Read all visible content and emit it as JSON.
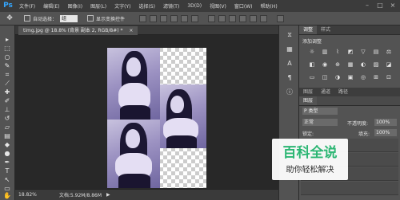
{
  "menubar": {
    "logo": "Ps",
    "items": [
      "文件(F)",
      "编辑(E)",
      "图像(I)",
      "图层(L)",
      "文字(Y)",
      "选择(S)",
      "滤镜(T)",
      "3D(D)",
      "视图(V)",
      "窗口(W)",
      "帮助(H)"
    ],
    "controls": [
      "–",
      "□",
      "×"
    ]
  },
  "options": {
    "autoselect_label": "自动选择：",
    "autoselect_value": "组",
    "transform_label": "显示变换控件"
  },
  "document": {
    "tab_title": "timg.jpg @ 18.8% (背景 副本 2, RGB/8#) *",
    "close": "×"
  },
  "status": {
    "zoom": "18.82%",
    "doc_size": "文档:5.92M/8.86M"
  },
  "panels": {
    "top_tabs": [
      "调整",
      "样式"
    ],
    "add_adjustment": "添加调整",
    "layer_tabs": [
      "图层",
      "通道",
      "路径"
    ],
    "filter_kind": "P 类型",
    "blend_mode": "正常",
    "opacity_label": "不透明度:",
    "opacity_value": "100%",
    "lock_label": "锁定:",
    "fill_label": "填充:",
    "fill_value": "100%"
  },
  "watermark": {
    "title": "百科全说",
    "subtitle": "助你轻松解决"
  },
  "icons": {
    "toolbar": [
      "move-icon",
      "marquee-icon",
      "lasso-icon",
      "quick-select-icon",
      "crop-icon",
      "eyedropper-icon",
      "healing-icon",
      "brush-icon",
      "stamp-icon",
      "history-brush-icon",
      "eraser-icon",
      "gradient-icon",
      "blur-icon",
      "dodge-icon",
      "pen-icon",
      "type-icon",
      "path-select-icon",
      "shape-icon",
      "hand-icon",
      "zoom-icon"
    ]
  }
}
